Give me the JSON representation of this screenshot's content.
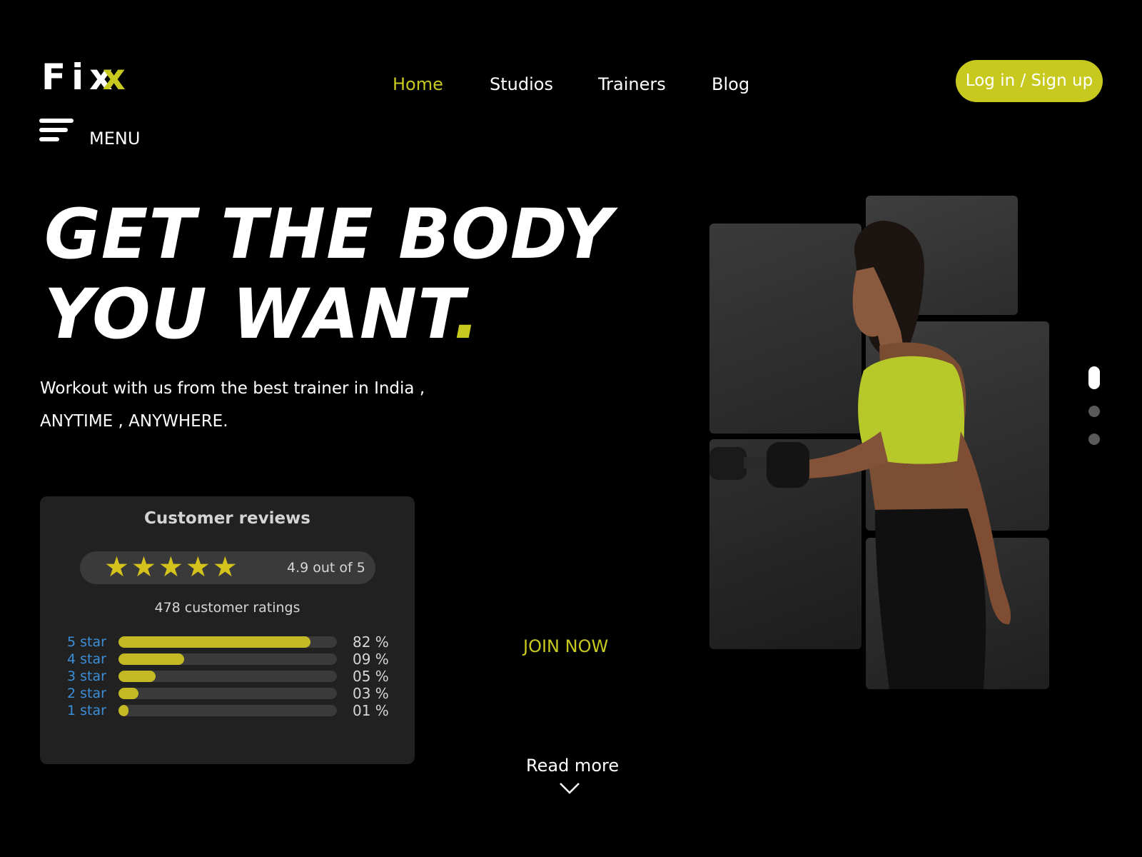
{
  "brand": {
    "logo_main": "Fix",
    "logo_accent": "x",
    "accent_color": "#c7c91f"
  },
  "nav": {
    "items": [
      {
        "label": "Home",
        "active": true
      },
      {
        "label": "Studios",
        "active": false
      },
      {
        "label": "Trainers",
        "active": false
      },
      {
        "label": "Blog",
        "active": false
      }
    ],
    "login_label": "Log in / Sign up"
  },
  "menu": {
    "label": "MENU",
    "icon": "hamburger-icon"
  },
  "hero": {
    "title_line1": "GET THE BODY",
    "title_line2": "YOU WANT",
    "title_dot": ".",
    "subtitle_line1": "Workout with us from the best trainer in India ,",
    "subtitle_line2": "ANYTIME , ANYWHERE."
  },
  "reviews": {
    "title": "Customer reviews",
    "stars": "★★★★★",
    "rating_text": "4.9 out of 5",
    "ratings_count": "478 customer ratings",
    "breakdown": [
      {
        "label": "5 star",
        "percent_text": "82 %",
        "fill": 0.88
      },
      {
        "label": "4 star",
        "percent_text": "09 %",
        "fill": 0.3
      },
      {
        "label": "3 star",
        "percent_text": "05 %",
        "fill": 0.17
      },
      {
        "label": "2 star",
        "percent_text": "03 %",
        "fill": 0.09
      },
      {
        "label": "1 star",
        "percent_text": "01 %",
        "fill": 0.045
      }
    ]
  },
  "cta": {
    "join_label": "JOIN NOW",
    "read_more_label": "Read more"
  },
  "carousel": {
    "slide_count": 3,
    "active_index": 0
  }
}
